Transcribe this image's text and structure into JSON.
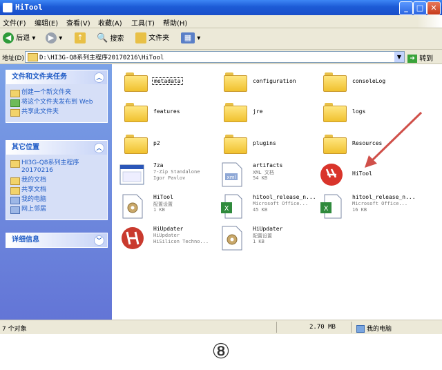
{
  "window": {
    "title": "HiTool",
    "min_label": "_",
    "max_label": "□",
    "close_label": "✕"
  },
  "menu": [
    "文件(F)",
    "编辑(E)",
    "查看(V)",
    "收藏(A)",
    "工具(T)",
    "帮助(H)"
  ],
  "toolbar": {
    "back_label": "后退",
    "search_label": "搜索",
    "folders_label": "文件夹"
  },
  "address": {
    "label": "地址(D)",
    "path": "D:\\HI3G-Q8系列主程序20170216\\HiTool",
    "go_label": "转到"
  },
  "sidebar": {
    "tasks_panel": {
      "title": "文件和文件夹任务",
      "items": [
        "创建一个新文件夹",
        "将这个文件夹发布到 Web",
        "共享此文件夹"
      ]
    },
    "places_panel": {
      "title": "其它位置",
      "items": [
        "HI3G-Q8系列主程序 20170216",
        "我的文档",
        "共享文档",
        "我的电脑",
        "网上邻居"
      ]
    },
    "details_panel": {
      "title": "详细信息"
    }
  },
  "files": [
    {
      "name": "metadata",
      "kind": "folder",
      "selected": true
    },
    {
      "name": "configuration",
      "kind": "folder"
    },
    {
      "name": "consoleLog",
      "kind": "folder"
    },
    {
      "name": "features",
      "kind": "folder"
    },
    {
      "name": "jre",
      "kind": "folder"
    },
    {
      "name": "logs",
      "kind": "folder"
    },
    {
      "name": "p2",
      "kind": "folder"
    },
    {
      "name": "plugins",
      "kind": "folder"
    },
    {
      "name": "Resources",
      "kind": "folder"
    },
    {
      "name": "7za",
      "line2": "7-Zip Standalone",
      "line3": "Igor Pavlov",
      "kind": "exe"
    },
    {
      "name": "artifacts",
      "line2": "XML 文档",
      "line3": "54 KB",
      "kind": "xml"
    },
    {
      "name": "HiTool",
      "kind": "hitool"
    },
    {
      "name": "HiTool",
      "line2": "配置设置",
      "line3": "1 KB",
      "kind": "ini"
    },
    {
      "name": "hitool_release_n...",
      "line2": "Microsoft Office...",
      "line3": "45 KB",
      "kind": "excel"
    },
    {
      "name": "hitool_release_n...",
      "line2": "Microsoft Office...",
      "line3": "16 KB",
      "kind": "excel"
    },
    {
      "name": "HiUpdater",
      "line2": "HiUpdater",
      "line3": "HiSilicon Techno...",
      "kind": "updater"
    },
    {
      "name": "HiUpdater",
      "line2": "配置设置",
      "line3": "1 KB",
      "kind": "ini"
    }
  ],
  "status": {
    "count": "7 个对象",
    "size": "2.70 MB",
    "location": "我的电脑"
  },
  "caption": "⑧",
  "colors": {
    "titlebar": "#1c5bd6",
    "sidebar": "#6f8fdf",
    "arrow": "#d0504a",
    "hitool_red": "#d9342b"
  }
}
